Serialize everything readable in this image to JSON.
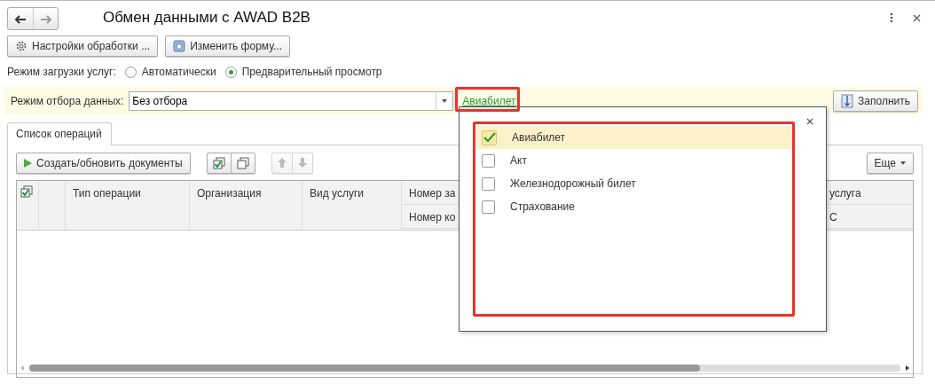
{
  "window": {
    "title": "Обмен данными с AWAD B2B"
  },
  "toolbar": {
    "buttons": [
      {
        "label": "Настройки обработки ...",
        "kind": "gear"
      },
      {
        "label": "Изменить форму...",
        "kind": "form"
      }
    ]
  },
  "load_mode": {
    "label": "Режим загрузки услуг:",
    "options": [
      {
        "label": "Автоматически",
        "selected": false
      },
      {
        "label": "Предварительный просмотр",
        "selected": true
      }
    ]
  },
  "filter": {
    "label": "Режим отбора данных:",
    "value": "Без отбора",
    "link": "Авиабилет",
    "fill_button": "Заполнить"
  },
  "tabs": [
    {
      "label": "Список операций",
      "selected": true
    }
  ],
  "operations_toolbar": {
    "create_button": "Создать/обновить документы",
    "more_button": "Еще"
  },
  "table": {
    "columns": [
      "Тип операции",
      "Организация",
      "Вид услуги"
    ],
    "column_4": [
      "Номер за",
      "Номер ко"
    ],
    "column_5": [
      "услуга",
      "С"
    ]
  },
  "popup": {
    "items": [
      {
        "label": "Авиабилет",
        "checked": true,
        "selected": true
      },
      {
        "label": "Акт",
        "checked": false,
        "selected": false
      },
      {
        "label": "Железнодорожный билет",
        "checked": false,
        "selected": false
      },
      {
        "label": "Страхование",
        "checked": false,
        "selected": false
      }
    ]
  }
}
